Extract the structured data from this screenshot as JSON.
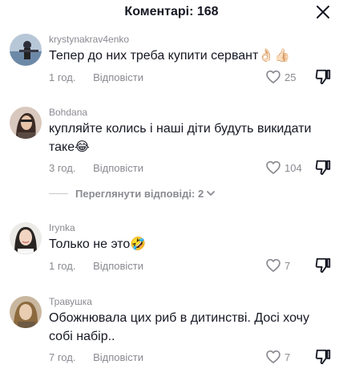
{
  "header": {
    "title": "Коментарі: 168",
    "close_icon": "close-icon"
  },
  "comments": [
    {
      "username": "krystynakrav4enko",
      "text": "Тепер до них треба купити сервант👌🏻👍🏻",
      "time": "1 год.",
      "reply": "Відповісти",
      "likes": "25"
    },
    {
      "username": "Bohdana",
      "text": "купляйте колись і наші діти будуть викидати таке😂",
      "time": "3 год.",
      "reply": "Відповісти",
      "likes": "104"
    },
    {
      "username": "Irynka",
      "text": "Только не это🤣",
      "time": "1 год.",
      "reply": "Відповісти",
      "likes": "7"
    },
    {
      "username": "Травушка",
      "text": "Обожнювала цих риб в дитинстві. Досі хочу собі набір..",
      "time": "7 год.",
      "reply": "Відповісти",
      "likes": "7"
    }
  ],
  "view_replies": {
    "label": "Переглянути відповіді: 2"
  },
  "icons": {
    "like": "heart-outline-icon",
    "dislike": "thumbs-down-icon",
    "expand": "chevron-down-icon"
  },
  "colors": {
    "text": "#161823",
    "muted": "#8a8b91",
    "background": "#ffffff"
  }
}
